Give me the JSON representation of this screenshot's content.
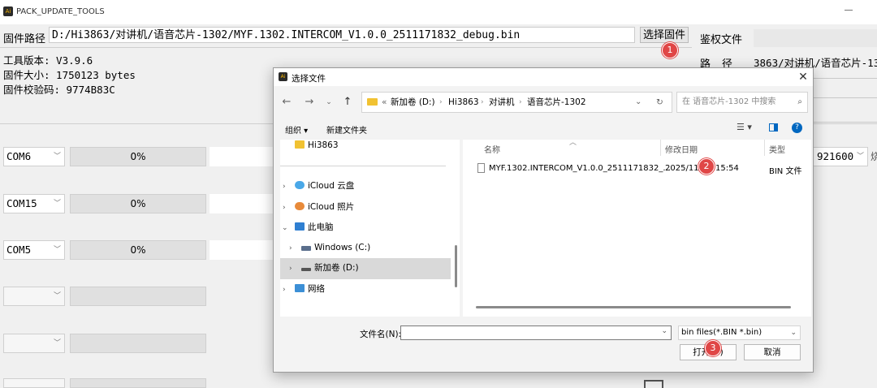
{
  "app": {
    "title": "PACK_UPDATE_TOOLS",
    "icon": "app-logo-icon"
  },
  "firmware": {
    "label": "固件路径",
    "path": "D:/Hi3863/对讲机/语音芯片-1302/MYF.1302.INTERCOM_V1.0.0_2511171832_debug.bin",
    "select_button": "选择固件",
    "tool_version": "工具版本: V3.9.6",
    "size": "固件大小: 1750123 bytes",
    "checksum": "固件校验码: 9774B83C"
  },
  "auth": {
    "label": "鉴权文件",
    "path_label": "路径",
    "path_value": "3863/对讲机/语音芯片-13"
  },
  "ports": [
    {
      "com": "COM6",
      "progress": "0%"
    },
    {
      "com": "COM15",
      "progress": "0%"
    },
    {
      "com": "COM5",
      "progress": "0%"
    },
    {
      "com": "",
      "progress": ""
    },
    {
      "com": "",
      "progress": ""
    },
    {
      "com": "",
      "progress": ""
    }
  ],
  "baud": {
    "value": "921600",
    "right_text": "烧"
  },
  "badges": [
    "1",
    "2",
    "3"
  ],
  "dialog": {
    "title": "选择文件",
    "breadcrumb": [
      "新加卷 (D:)",
      "Hi3863",
      "对讲机",
      "语音芯片-1302"
    ],
    "breadcrumb_prefix": "«",
    "search_placeholder": "在 语音芯片-1302 中搜索",
    "toolbar": {
      "organize": "组织 ▾",
      "new_folder": "新建文件夹"
    },
    "nav": [
      {
        "label": "Hi3863",
        "icon": "folder-icon"
      },
      {
        "label": "iCloud 云盘",
        "icon": "icloud-drive-icon"
      },
      {
        "label": "iCloud 照片",
        "icon": "icloud-photos-icon"
      },
      {
        "label": "此电脑",
        "icon": "this-pc-icon"
      },
      {
        "label": "Windows (C:)",
        "icon": "windows-drive-icon"
      },
      {
        "label": "新加卷 (D:)",
        "icon": "drive-icon"
      },
      {
        "label": "网络",
        "icon": "network-icon"
      }
    ],
    "columns": {
      "name": "名称",
      "date": "修改日期",
      "type": "类型"
    },
    "files": [
      {
        "name": "MYF.1302.INTERCOM_V1.0.0_2511171832_...",
        "date": "2025/11/",
        "time": "15:54",
        "type": "BIN 文件"
      }
    ],
    "filename_label": "文件名(N):",
    "filename_value": "",
    "filter": "bin files(*.BIN *.bin)",
    "open_button": "打开(O)",
    "cancel_button": "取消"
  },
  "colors": {
    "badge": "#e04646",
    "selected": "#d9d9d9",
    "accent": "#0067c0"
  }
}
